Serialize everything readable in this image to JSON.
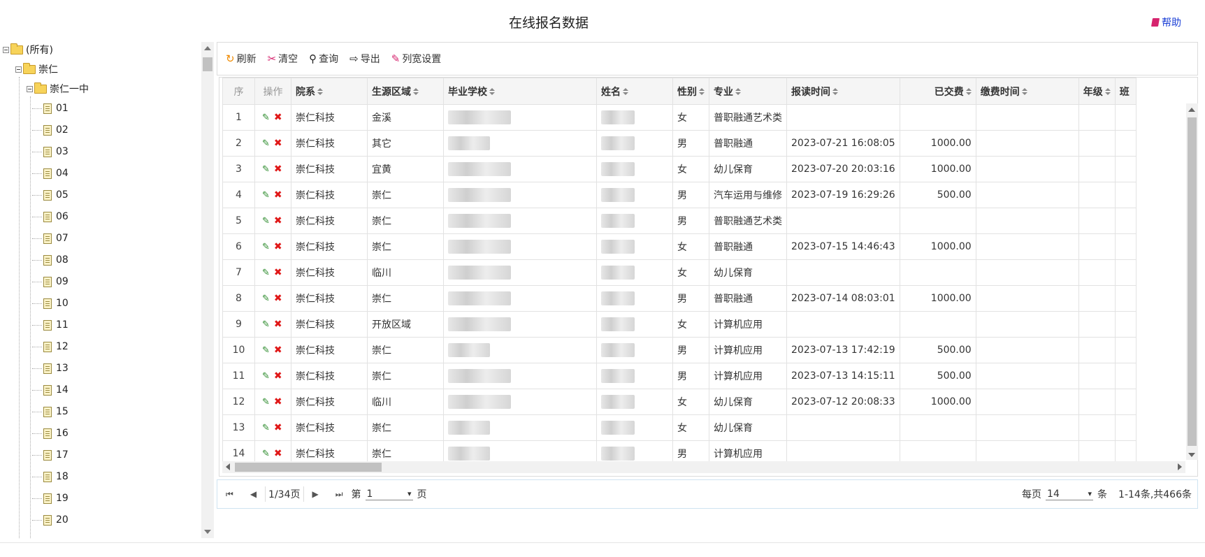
{
  "title": "在线报名数据",
  "help": "帮助",
  "tree": {
    "root": "(所有)",
    "level1": "崇仁",
    "level2": "崇仁一中",
    "classes": [
      "01",
      "02",
      "03",
      "04",
      "05",
      "06",
      "07",
      "08",
      "09",
      "10",
      "11",
      "12",
      "13",
      "14",
      "15",
      "16",
      "17",
      "18",
      "19",
      "20"
    ]
  },
  "toolbar": {
    "refresh": "刷新",
    "clear": "清空",
    "query": "查询",
    "export": "导出",
    "column_width": "列宽设置"
  },
  "columns": {
    "seq": "序",
    "ops": "操作",
    "dept": "院系",
    "region": "生源区域",
    "school": "毕业学校",
    "name": "姓名",
    "gender": "性别",
    "major": "专业",
    "reg_time": "报读时间",
    "paid": "已交费",
    "pay_time": "缴费时间",
    "grade": "年级",
    "class": "班"
  },
  "rows": [
    {
      "seq": "1",
      "dept": "崇仁科技",
      "region": "金溪",
      "gender": "女",
      "major": "普职融通艺术类",
      "reg_time": "",
      "paid": ""
    },
    {
      "seq": "2",
      "dept": "崇仁科技",
      "region": "其它",
      "gender": "男",
      "major": "普职融通",
      "reg_time": "2023-07-21 16:08:05",
      "paid": "1000.00"
    },
    {
      "seq": "3",
      "dept": "崇仁科技",
      "region": "宜黄",
      "gender": "女",
      "major": "幼儿保育",
      "reg_time": "2023-07-20 20:03:16",
      "paid": "1000.00"
    },
    {
      "seq": "4",
      "dept": "崇仁科技",
      "region": "崇仁",
      "gender": "男",
      "major": "汽车运用与维修",
      "reg_time": "2023-07-19 16:29:26",
      "paid": "500.00"
    },
    {
      "seq": "5",
      "dept": "崇仁科技",
      "region": "崇仁",
      "gender": "男",
      "major": "普职融通艺术类",
      "reg_time": "",
      "paid": ""
    },
    {
      "seq": "6",
      "dept": "崇仁科技",
      "region": "崇仁",
      "gender": "女",
      "major": "普职融通",
      "reg_time": "2023-07-15 14:46:43",
      "paid": "1000.00"
    },
    {
      "seq": "7",
      "dept": "崇仁科技",
      "region": "临川",
      "gender": "女",
      "major": "幼儿保育",
      "reg_time": "",
      "paid": ""
    },
    {
      "seq": "8",
      "dept": "崇仁科技",
      "region": "崇仁",
      "gender": "男",
      "major": "普职融通",
      "reg_time": "2023-07-14 08:03:01",
      "paid": "1000.00"
    },
    {
      "seq": "9",
      "dept": "崇仁科技",
      "region": "开放区域",
      "gender": "女",
      "major": "计算机应用",
      "reg_time": "",
      "paid": ""
    },
    {
      "seq": "10",
      "dept": "崇仁科技",
      "region": "崇仁",
      "gender": "男",
      "major": "计算机应用",
      "reg_time": "2023-07-13 17:42:19",
      "paid": "500.00"
    },
    {
      "seq": "11",
      "dept": "崇仁科技",
      "region": "崇仁",
      "gender": "男",
      "major": "计算机应用",
      "reg_time": "2023-07-13 14:15:11",
      "paid": "500.00"
    },
    {
      "seq": "12",
      "dept": "崇仁科技",
      "region": "临川",
      "gender": "女",
      "major": "幼儿保育",
      "reg_time": "2023-07-12 20:08:33",
      "paid": "1000.00"
    },
    {
      "seq": "13",
      "dept": "崇仁科技",
      "region": "崇仁",
      "gender": "女",
      "major": "幼儿保育",
      "reg_time": "",
      "paid": ""
    },
    {
      "seq": "14",
      "dept": "崇仁科技",
      "region": "崇仁",
      "gender": "男",
      "major": "计算机应用",
      "reg_time": "",
      "paid": ""
    }
  ],
  "pager": {
    "page_info": "1/34页",
    "page_prefix": "第",
    "page_value": "1",
    "page_suffix": "页",
    "per_page_label": "每页",
    "per_page_value": "14",
    "per_page_unit": "条",
    "summary": "1-14条,共466条"
  }
}
